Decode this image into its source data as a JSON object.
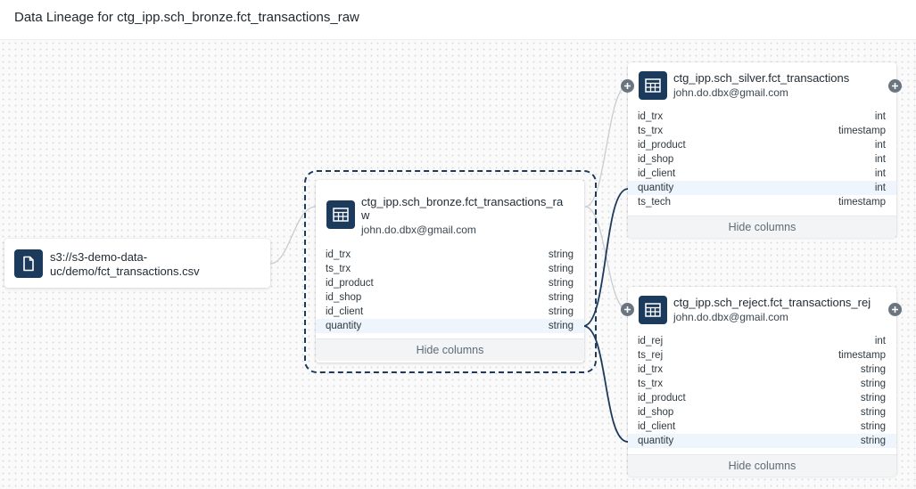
{
  "header": {
    "title": "Data Lineage for ctg_ipp.sch_bronze.fct_transactions_raw"
  },
  "colors": {
    "accent": "#1b3a5c",
    "edge_highlight": "#1b3a5c",
    "edge_default": "#c9cdd1",
    "highlight_row": "#eef5fc"
  },
  "source_file": {
    "path": "s3://s3-demo-data-uc/demo/fct_transactions.csv",
    "icon": "file-icon"
  },
  "bronze": {
    "name": "ctg_ipp.sch_bronze.fct_transactions_raw",
    "owner": "john.do.dbx@gmail.com",
    "icon": "table-icon",
    "columns": [
      {
        "name": "id_trx",
        "type": "string"
      },
      {
        "name": "ts_trx",
        "type": "string"
      },
      {
        "name": "id_product",
        "type": "string"
      },
      {
        "name": "id_shop",
        "type": "string"
      },
      {
        "name": "id_client",
        "type": "string"
      },
      {
        "name": "quantity",
        "type": "string"
      }
    ],
    "hide_label": "Hide columns"
  },
  "silver": {
    "name": "ctg_ipp.sch_silver.fct_transactions",
    "owner": "john.do.dbx@gmail.com",
    "icon": "table-icon",
    "columns": [
      {
        "name": "id_trx",
        "type": "int"
      },
      {
        "name": "ts_trx",
        "type": "timestamp"
      },
      {
        "name": "id_product",
        "type": "int"
      },
      {
        "name": "id_shop",
        "type": "int"
      },
      {
        "name": "id_client",
        "type": "int"
      },
      {
        "name": "quantity",
        "type": "int"
      },
      {
        "name": "ts_tech",
        "type": "timestamp"
      }
    ],
    "hide_label": "Hide columns"
  },
  "reject": {
    "name": "ctg_ipp.sch_reject.fct_transactions_rej",
    "owner": "john.do.dbx@gmail.com",
    "icon": "table-icon",
    "columns": [
      {
        "name": "id_rej",
        "type": "int"
      },
      {
        "name": "ts_rej",
        "type": "timestamp"
      },
      {
        "name": "id_trx",
        "type": "string"
      },
      {
        "name": "ts_trx",
        "type": "string"
      },
      {
        "name": "id_product",
        "type": "string"
      },
      {
        "name": "id_shop",
        "type": "string"
      },
      {
        "name": "id_client",
        "type": "string"
      },
      {
        "name": "quantity",
        "type": "string"
      }
    ],
    "hide_label": "Hide columns"
  }
}
